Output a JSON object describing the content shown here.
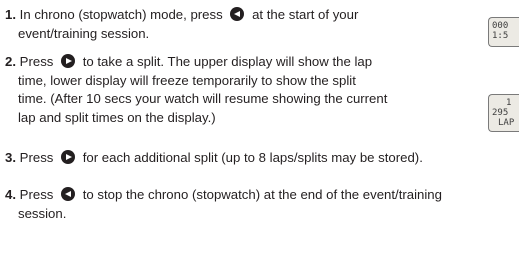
{
  "steps": [
    {
      "number": "1.",
      "lines": [
        "In chrono (stopwatch) mode, press",
        "at the start of your",
        "event/training session."
      ]
    },
    {
      "number": "2.",
      "lines": [
        "Press",
        "to take a split. The upper display will show the lap",
        "time, lower display will freeze temporarily to show the split",
        "time. (After 10 secs your watch will resume showing the current",
        "lap and split times on the display.)"
      ]
    },
    {
      "number": "3.",
      "lines": [
        "Press",
        "for each additional split (up to 8 laps/splits may be stored)."
      ]
    },
    {
      "number": "4.",
      "lines": [
        "Press",
        "to stop the chrono (stopwatch) at the end of the event/training",
        "session."
      ]
    }
  ],
  "icons": {
    "left": "left-arrow-button-icon",
    "right": "right-arrow-button-icon"
  },
  "watch_displays": [
    {
      "top": "000",
      "bottom": "1:5"
    },
    {
      "top": "1",
      "middle": "295",
      "bottom": "LAP"
    }
  ]
}
